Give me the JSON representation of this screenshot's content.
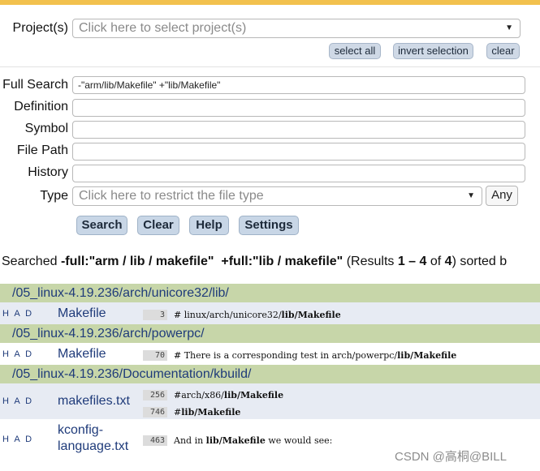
{
  "search_form": {
    "project_label": "Project(s)",
    "project_placeholder": "Click here to select project(s)",
    "select_all": "select all",
    "invert_selection": "invert selection",
    "clear_projects": "clear",
    "fields": [
      {
        "label": "Full Search",
        "value": "-\"arm/lib/Makefile\" +\"lib/Makefile\""
      },
      {
        "label": "Definition",
        "value": ""
      },
      {
        "label": "Symbol",
        "value": ""
      },
      {
        "label": "File Path",
        "value": ""
      },
      {
        "label": "History",
        "value": ""
      }
    ],
    "type_label": "Type",
    "type_placeholder": "Click here to restrict the file type",
    "any_button": "Any",
    "search_button": "Search",
    "clear_button": "Clear",
    "help_button": "Help",
    "settings_button": "Settings"
  },
  "results_summary": {
    "prefix": "Searched ",
    "query1": "-full:\"arm / lib / makefile\"",
    "query2": "+full:\"lib / makefile\"",
    "results_open": "(Results ",
    "range": "1 – 4",
    "of_text": " of ",
    "total": "4",
    "suffix": ") sorted b"
  },
  "results": [
    {
      "dir": "/05_linux-4.19.236/arch/unicore32/lib/",
      "files": [
        {
          "had": "H A D",
          "name": "Makefile",
          "lines": [
            {
              "num": "3",
              "pre": "# linux/arch/unicore32/",
              "match": "lib/Makefile",
              "post": ""
            }
          ]
        }
      ]
    },
    {
      "dir": "/05_linux-4.19.236/arch/powerpc/",
      "files": [
        {
          "had": "H A D",
          "name": "Makefile",
          "lines": [
            {
              "num": "70",
              "pre": "# There is a corresponding test in arch/powerpc/",
              "match": "lib/Makefile",
              "post": ""
            }
          ]
        }
      ]
    },
    {
      "dir": "/05_linux-4.19.236/Documentation/kbuild/",
      "files": [
        {
          "had": "H A D",
          "name": "makefiles.txt",
          "lines": [
            {
              "num": "256",
              "pre": "#arch/x86/",
              "match": "lib/Makefile",
              "post": ""
            },
            {
              "num": "746",
              "pre": "#",
              "match": "lib/Makefile",
              "post": ""
            }
          ]
        },
        {
          "had": "H A D",
          "name_line1": "kconfig-",
          "name_line2": "language.txt",
          "lines": [
            {
              "num": "463",
              "pre": "And in ",
              "match": "lib/Makefile",
              "post": " we would see:"
            }
          ]
        }
      ]
    }
  ],
  "watermark": "CSDN @高桐@BILL",
  "colors": {
    "accent_bar": "#f2c14e",
    "dir_header": "#c7d6a9",
    "row_shaded": "#e7ebf3",
    "link": "#1f3b7a",
    "button": "#c8d6e6"
  }
}
